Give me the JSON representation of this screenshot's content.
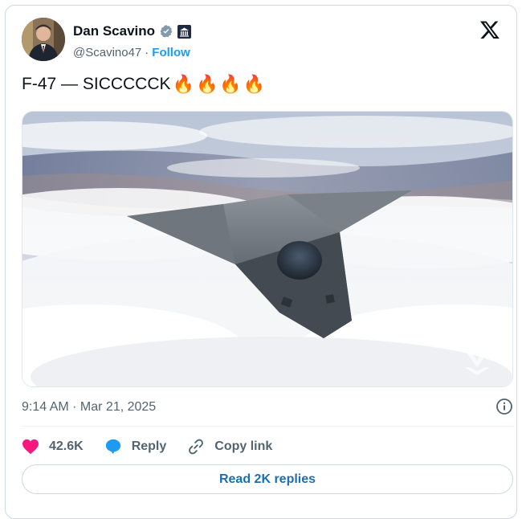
{
  "author": {
    "name": "Dan Scavino",
    "handle": "@Scavino47",
    "separator": "·",
    "follow_label": "Follow",
    "avatar_icon": "user-avatar",
    "verified_icon": "verified-badge-icon",
    "affiliate_icon": "government-building-icon"
  },
  "brand": {
    "logo_icon": "x-logo-icon"
  },
  "tweet": {
    "text": "F-47 — SICCCCCK",
    "emoji": [
      "🔥",
      "🔥",
      "🔥",
      "🔥"
    ]
  },
  "media": {
    "description_icon": "fighter-jet-image",
    "watermark_icon": "air-force-emblem-icon"
  },
  "meta": {
    "timestamp": "9:14 AM · Mar 21, 2025",
    "info_icon": "info-icon"
  },
  "actions": {
    "like_count": "42.6K",
    "reply_label": "Reply",
    "copy_link_label": "Copy link",
    "heart_icon": "heart-icon",
    "reply_icon": "reply-bubble-icon",
    "link_icon": "link-icon"
  },
  "footer": {
    "read_replies_label": "Read 2K replies"
  },
  "colors": {
    "accent": "#1d9bf0",
    "like": "#f91880",
    "text": "#0f1419",
    "muted": "#536471",
    "border": "#cfd9de"
  }
}
